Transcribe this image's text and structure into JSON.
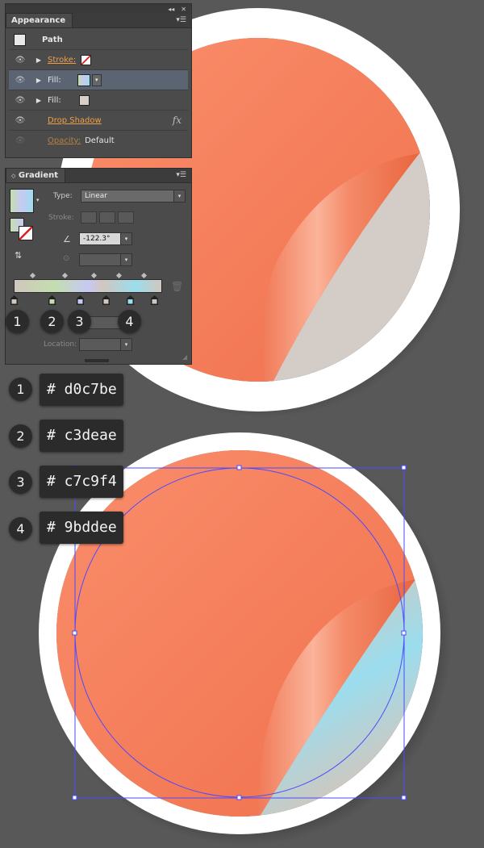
{
  "appearance_panel": {
    "title": "Appearance",
    "header": "Path",
    "rows": [
      {
        "label": "Stroke:",
        "type": "stroke"
      },
      {
        "label": "Fill:",
        "type": "fill",
        "selected": true
      },
      {
        "label": "Fill:",
        "type": "fill"
      },
      {
        "label": "Drop Shadow",
        "type": "effect"
      },
      {
        "label": "Opacity:",
        "value": "Default",
        "type": "opacity"
      }
    ],
    "fx_label": "fx"
  },
  "gradient_panel": {
    "title": "Gradient",
    "type_label": "Type:",
    "type_value": "Linear",
    "stroke_label": "Stroke:",
    "angle_value": "-122.3°",
    "location_label": "Location:",
    "opacity_label": "Opacity:",
    "stop_colors": [
      "#d0c7be",
      "#c3deae",
      "#c7c9f4",
      "#d0c7be",
      "#9bddee",
      "#d0c7be"
    ]
  },
  "color_labels": [
    {
      "number": "1",
      "hex": "# d0c7be"
    },
    {
      "number": "2",
      "hex": "# c3deae"
    },
    {
      "number": "3",
      "hex": "# c7c9f4"
    },
    {
      "number": "4",
      "hex": "# 9bddee"
    }
  ],
  "panel_number_badges": [
    "1",
    "2",
    "3",
    "4"
  ],
  "icons": [
    "eye-icon",
    "expand-triangle-icon",
    "fx-icon",
    "trash-icon",
    "panel-menu-icon",
    "collapse-icon",
    "close-icon"
  ],
  "colors": {
    "background": "#585858",
    "sticker_orange": "#f7825e",
    "sticker_border": "#ffffff",
    "selection_blue": "#4b4bff"
  }
}
